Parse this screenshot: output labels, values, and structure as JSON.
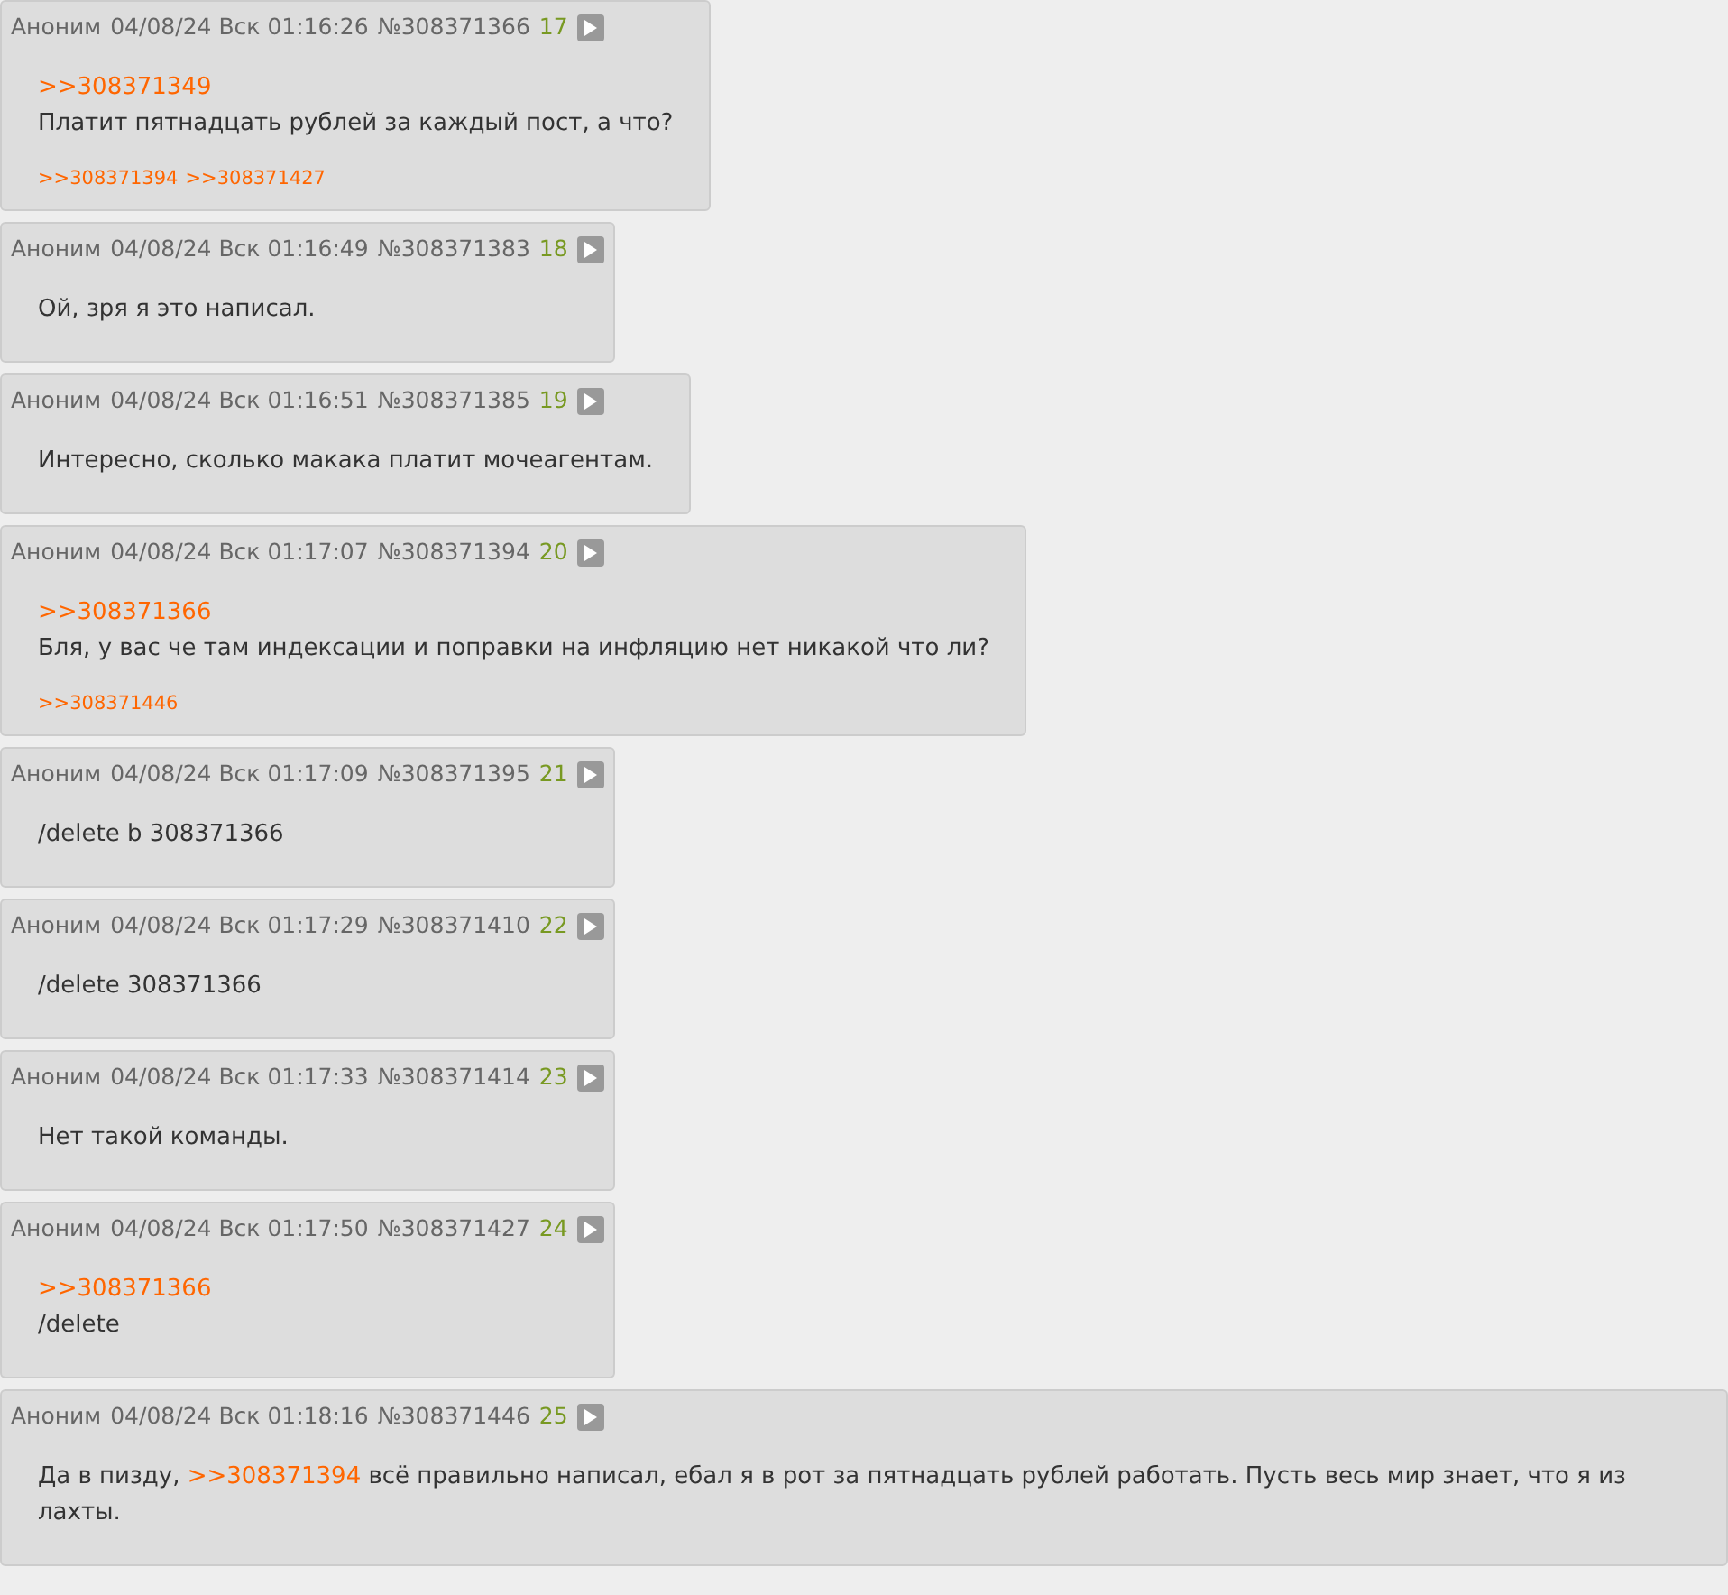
{
  "posts": [
    {
      "author": "Аноним",
      "date": "04/08/24 Вск 01:16:26",
      "number": "№308371366",
      "index": "17",
      "body": [
        [
          {
            "kind": "link",
            "text": ">>308371349"
          }
        ],
        [
          {
            "kind": "text",
            "text": "Платит пятнадцать рублей за каждый пост, а что?"
          }
        ]
      ],
      "replies": [
        ">>308371394",
        ">>308371427"
      ]
    },
    {
      "author": "Аноним",
      "date": "04/08/24 Вск 01:16:49",
      "number": "№308371383",
      "index": "18",
      "body": [
        [
          {
            "kind": "text",
            "text": "Ой, зря я это написал."
          }
        ]
      ]
    },
    {
      "author": "Аноним",
      "date": "04/08/24 Вск 01:16:51",
      "number": "№308371385",
      "index": "19",
      "body": [
        [
          {
            "kind": "text",
            "text": "Интересно, сколько макака платит мочеагентам."
          }
        ]
      ]
    },
    {
      "author": "Аноним",
      "date": "04/08/24 Вск 01:17:07",
      "number": "№308371394",
      "index": "20",
      "body": [
        [
          {
            "kind": "link",
            "text": ">>308371366"
          }
        ],
        [
          {
            "kind": "text",
            "text": "Бля, у вас че там индексации и поправки на инфляцию нет никакой что ли?"
          }
        ]
      ],
      "replies": [
        ">>308371446"
      ]
    },
    {
      "author": "Аноним",
      "date": "04/08/24 Вск 01:17:09",
      "number": "№308371395",
      "index": "21",
      "body": [
        [
          {
            "kind": "text",
            "text": "/delete b 308371366"
          }
        ]
      ]
    },
    {
      "author": "Аноним",
      "date": "04/08/24 Вск 01:17:29",
      "number": "№308371410",
      "index": "22",
      "body": [
        [
          {
            "kind": "text",
            "text": "/delete 308371366"
          }
        ]
      ]
    },
    {
      "author": "Аноним",
      "date": "04/08/24 Вск 01:17:33",
      "number": "№308371414",
      "index": "23",
      "body": [
        [
          {
            "kind": "text",
            "text": "Нет такой команды."
          }
        ]
      ]
    },
    {
      "author": "Аноним",
      "date": "04/08/24 Вск 01:17:50",
      "number": "№308371427",
      "index": "24",
      "body": [
        [
          {
            "kind": "link",
            "text": ">>308371366"
          }
        ],
        [
          {
            "kind": "text",
            "text": "/delete"
          }
        ]
      ]
    },
    {
      "author": "Аноним",
      "date": "04/08/24 Вск 01:18:16",
      "number": "№308371446",
      "index": "25",
      "body": [
        [
          {
            "kind": "text",
            "text": "Да в пизду, "
          },
          {
            "kind": "link",
            "text": ">>308371394"
          },
          {
            "kind": "text",
            "text": " всё правильно написал, ебал я в рот за пятнадцать рублей работать. Пусть весь мир знает, что я из лахты."
          }
        ]
      ]
    }
  ]
}
